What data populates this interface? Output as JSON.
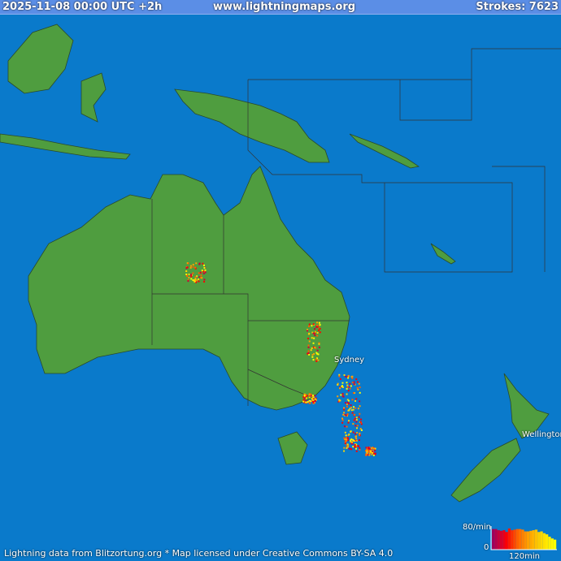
{
  "header": {
    "datetime": "2025-11-08 00:00 UTC +2h",
    "site": "www.lightningmaps.org",
    "strokes_label": "Strokes: 7623"
  },
  "footer": {
    "credit": "Lightning data from Blitzortung.org   *  Map licensed under Creative Commons BY-SA 4.0"
  },
  "places": {
    "sydney": "Sydney",
    "wellington": "Wellington"
  },
  "legend": {
    "max_label": "80/min",
    "zero_label": "0",
    "time_label": "120min",
    "ymax": 80,
    "rates": [
      70,
      70,
      66,
      64,
      66,
      60,
      72,
      66,
      68,
      70,
      70,
      68,
      62,
      62,
      64,
      66,
      68,
      60,
      62,
      56,
      52,
      44,
      38,
      34
    ],
    "colors": [
      "#a0005a",
      "#b4004a",
      "#c8003a",
      "#d8002a",
      "#e8001a",
      "#ff0000",
      "#ff1800",
      "#ff3000",
      "#ff4800",
      "#ff6000",
      "#ff7000",
      "#ff8000",
      "#ff9000",
      "#ffa000",
      "#ffa800",
      "#ffb400",
      "#ffc000",
      "#ffcc00",
      "#ffd800",
      "#ffe000",
      "#ffe800",
      "#fff000",
      "#fff800",
      "#ffff00"
    ]
  },
  "colors": {
    "sea": "#0a7acb",
    "land": "#4a9a3a",
    "header": "#5b8ee6"
  }
}
